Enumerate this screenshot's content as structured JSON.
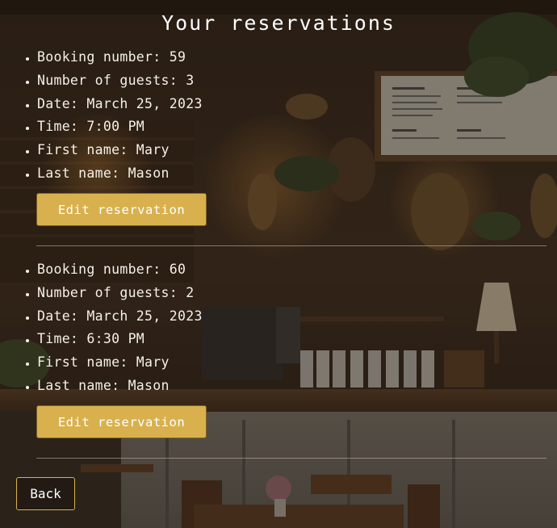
{
  "page": {
    "title": "Your reservations"
  },
  "reservations": [
    {
      "booking_number": "Booking number: 59",
      "guests": "Number of guests: 3",
      "date": "Date: March 25, 2023",
      "time": "Time: 7:00 PM",
      "first_name": "First name: Mary",
      "last_name": "Last name: Mason",
      "edit_label": "Edit reservation"
    },
    {
      "booking_number": "Booking number: 60",
      "guests": "Number of guests: 2",
      "date": "Date: March 25, 2023",
      "time": "Time: 6:30 PM",
      "first_name": "First name: Mary",
      "last_name": "Last name: Mason",
      "edit_label": "Edit reservation"
    }
  ],
  "actions": {
    "back_label": "Back"
  },
  "colors": {
    "accent": "#d8b14e",
    "text": "#f4f1e8",
    "background": "#2a2118"
  }
}
